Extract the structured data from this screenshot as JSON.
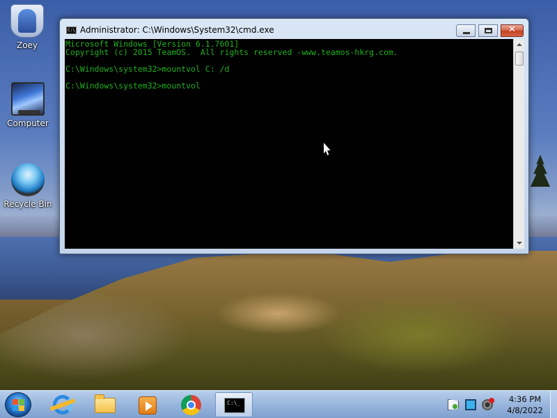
{
  "desktop": {
    "icons": [
      {
        "label": "Zoey",
        "icon": "user-folder-icon"
      },
      {
        "label": "Computer",
        "icon": "computer-icon"
      },
      {
        "label": "Recycle Bin",
        "icon": "recycle-bin-icon"
      }
    ]
  },
  "window": {
    "title": "Administrator: C:\\Windows\\System32\\cmd.exe",
    "icon_glyph": "C:\\_",
    "buttons": {
      "minimize": "minimize-icon",
      "maximize": "maximize-icon",
      "close": "✕"
    },
    "console": {
      "text_color": "#20b020",
      "background": "#000000",
      "lines": [
        "Microsoft Windows [Version 6.1.7601]",
        "Copyright (c) 2015 TeamOS.  All rights reserved -www.teamos-hkrg.com.",
        "",
        "C:\\Windows\\system32>mountvol C: /d",
        "",
        "C:\\Windows\\system32>mountvol"
      ]
    }
  },
  "taskbar": {
    "items": [
      {
        "name": "internet-explorer",
        "icon": "internet-explorer-icon"
      },
      {
        "name": "windows-explorer",
        "icon": "folder-icon"
      },
      {
        "name": "media-player",
        "icon": "media-player-icon"
      },
      {
        "name": "google-chrome",
        "icon": "chrome-icon"
      },
      {
        "name": "command-prompt",
        "icon": "cmd-icon",
        "active": true,
        "glyph": "C:\\_"
      }
    ],
    "clock": {
      "time": "4:36 PM",
      "date": "4/8/2022"
    }
  },
  "colors": {
    "console_text": "#20b020",
    "taskbar": "#96b4dc",
    "close_button": "#c5401f"
  }
}
